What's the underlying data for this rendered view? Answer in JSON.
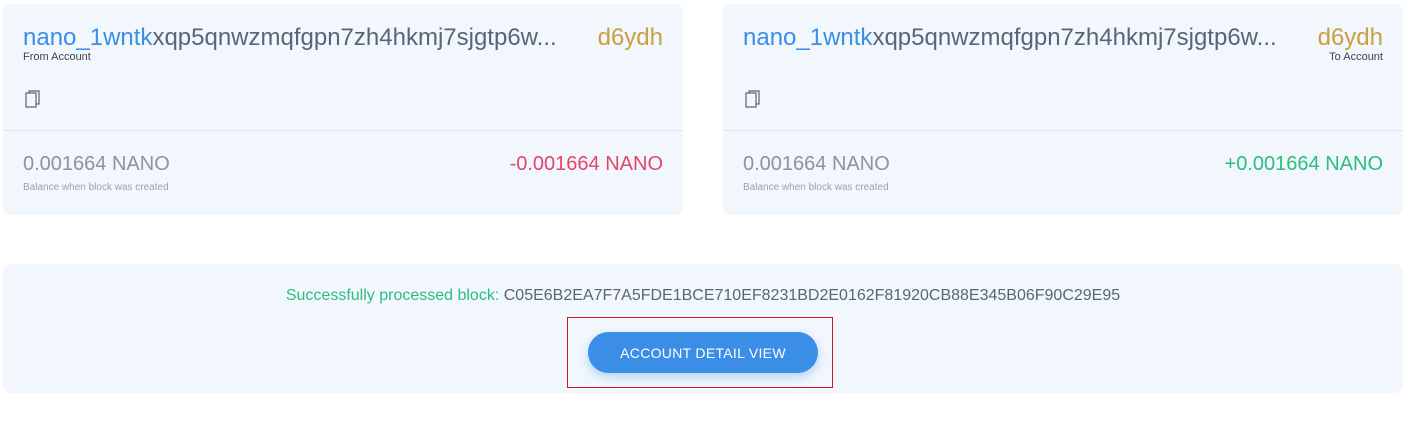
{
  "from_card": {
    "address_prefix": "nano_1wntk",
    "address_middle": "xqp5qnwzmqfgpn7zh4hkmj7sjgtp6w...",
    "address_suffix": "d6ydh",
    "label": "From Account",
    "balance": "0.001664 NANO",
    "balance_label": "Balance when block was created",
    "amount": "-0.001664 NANO",
    "icon": "copy-icon"
  },
  "to_card": {
    "address_prefix": "nano_1wntk",
    "address_middle": "xqp5qnwzmqfgpn7zh4hkmj7sjgtp6w...",
    "address_suffix": "d6ydh",
    "label": "To Account",
    "balance": "0.001664 NANO",
    "balance_label": "Balance when block was created",
    "amount": "+0.001664 NANO",
    "icon": "copy-icon"
  },
  "result": {
    "status_text": "Successfully processed block:",
    "block_hash": "C05E6B2EA7F7A5FDE1BCE710EF8231BD2E0162F81920CB88E345B06F90C29E95",
    "button_label": "ACCOUNT DETAIL VIEW"
  },
  "colors": {
    "accent": "#3a8ee6",
    "negative": "#e6456a",
    "positive": "#2dbd7c",
    "suffix": "#c9a040",
    "card_bg": "#f1f7fd",
    "highlight": "#cc1c1c"
  }
}
